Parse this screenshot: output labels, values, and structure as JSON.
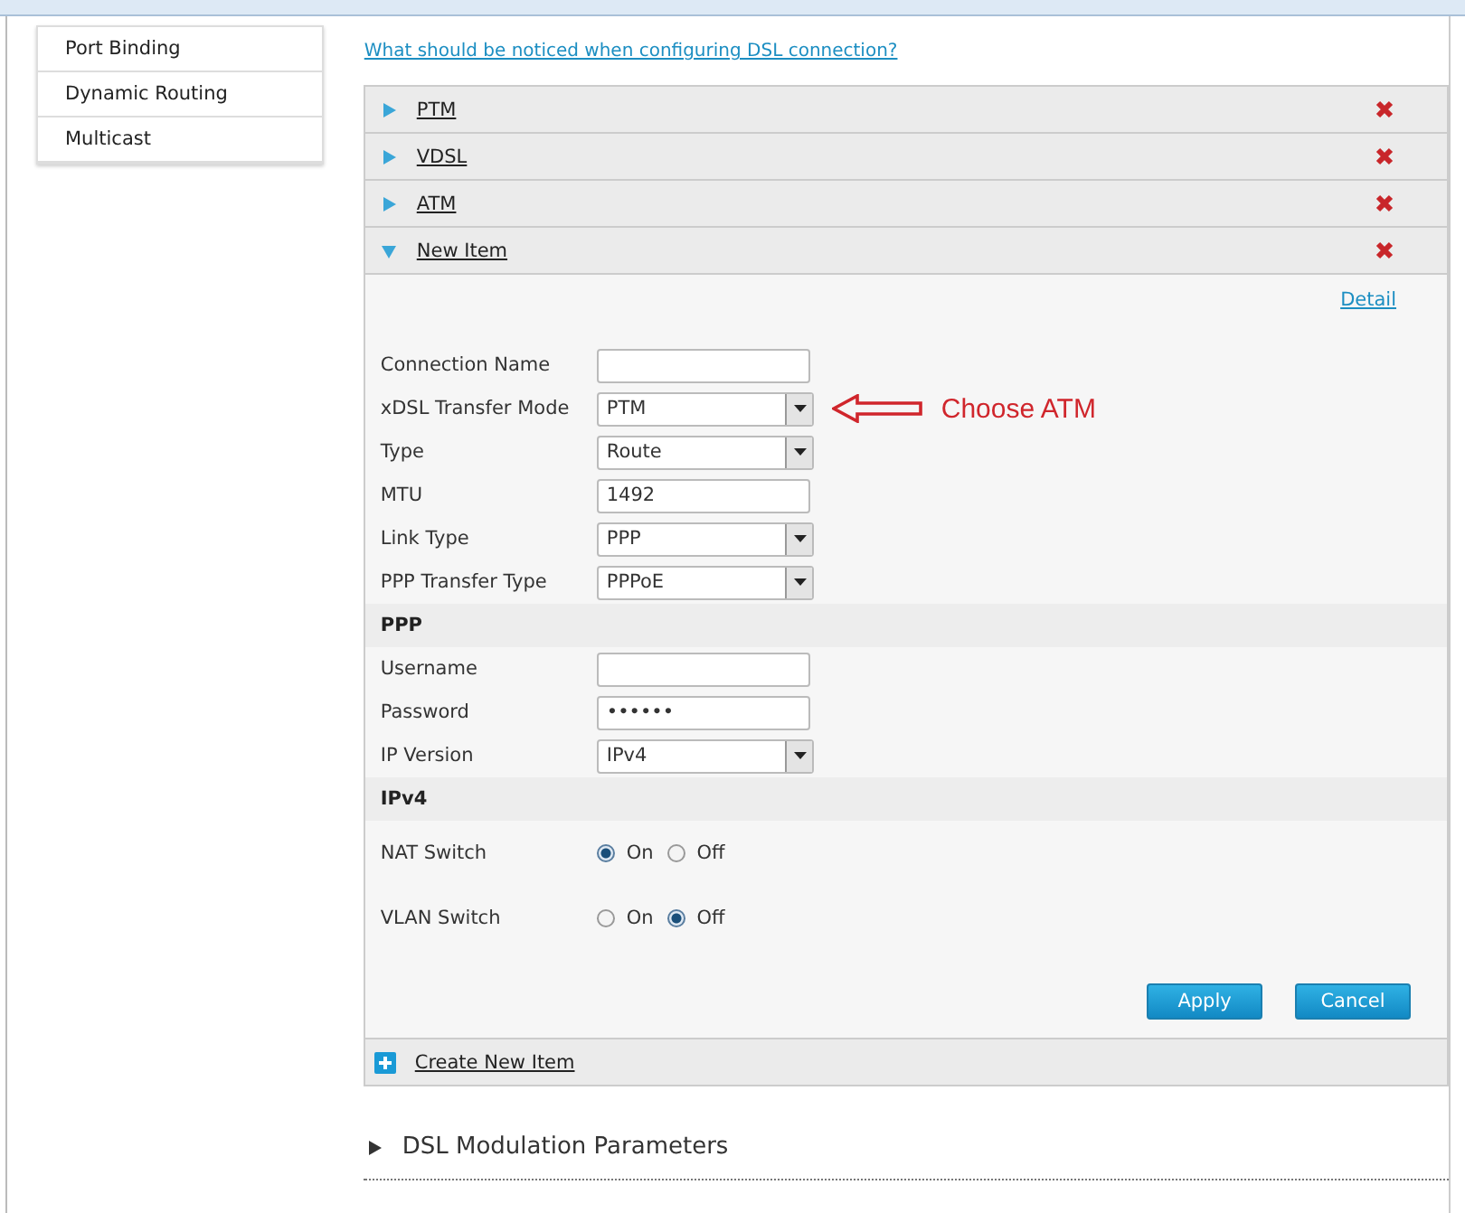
{
  "sidebar": {
    "items": [
      {
        "label": "Port Binding",
        "selected": false
      },
      {
        "label": "Dynamic Routing",
        "selected": false
      },
      {
        "label": "Multicast",
        "selected": false
      }
    ]
  },
  "help_link": "What should be noticed when configuring DSL connection?",
  "connections": [
    {
      "name": "PTM",
      "expanded": false
    },
    {
      "name": "VDSL",
      "expanded": false
    },
    {
      "name": "ATM",
      "expanded": false
    },
    {
      "name": "New Item",
      "expanded": true
    }
  ],
  "detail_link": "Detail",
  "form": {
    "rows": [
      {
        "kind": "text",
        "label": "Connection Name"
      },
      {
        "kind": "select",
        "label": "xDSL Transfer Mode",
        "value": "PTM",
        "annotation": "Choose ATM"
      },
      {
        "kind": "select",
        "label": "Type",
        "value": "Route"
      },
      {
        "kind": "text",
        "label": "MTU",
        "value": "1492"
      },
      {
        "kind": "select",
        "label": "Link Type",
        "value": "PPP"
      },
      {
        "kind": "select",
        "label": "PPP Transfer Type",
        "value": "PPPoE"
      },
      {
        "kind": "section",
        "label": "PPP"
      },
      {
        "kind": "text",
        "label": "Username"
      },
      {
        "kind": "password",
        "label": "Password",
        "value": "••••••"
      },
      {
        "kind": "select",
        "label": "IP Version",
        "value": "IPv4"
      },
      {
        "kind": "section",
        "label": "IPv4"
      },
      {
        "kind": "radio",
        "label": "NAT Switch",
        "options": [
          {
            "label": "On",
            "selected": true
          },
          {
            "label": "Off",
            "selected": false
          }
        ]
      },
      {
        "kind": "radio",
        "label": "VLAN Switch",
        "options": [
          {
            "label": "On",
            "selected": false
          },
          {
            "label": "Off",
            "selected": true
          }
        ]
      }
    ]
  },
  "buttons": [
    "Apply",
    "Cancel"
  ],
  "create_link": "Create New Item",
  "section": {
    "title": "DSL Modulation Parameters",
    "expanded": false
  }
}
